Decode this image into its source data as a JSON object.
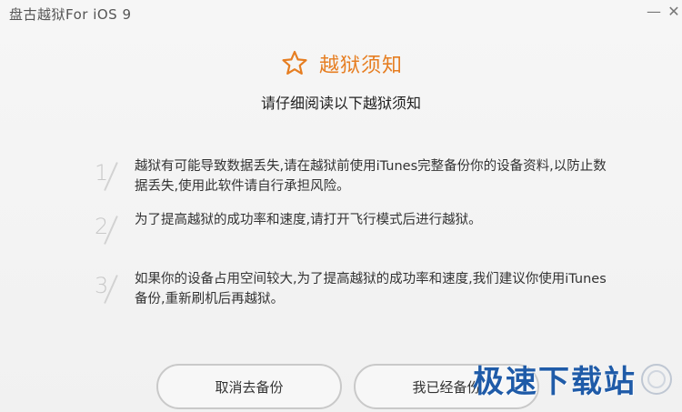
{
  "window": {
    "title": "盘古越狱For iOS 9",
    "minimize_glyph": "—",
    "close_glyph": "✕"
  },
  "brand": {
    "icon": "star-icon",
    "title": "越狱须知",
    "accent_color": "#e67e22"
  },
  "subtitle": "请仔细阅读以下越狱须知",
  "notices": [
    {
      "num": "1",
      "text": "越狱有可能导致数据丢失,请在越狱前使用iTunes完整备份你的设备资料,以防止数据丢失,使用此软件请自行承担风险。"
    },
    {
      "num": "2",
      "text": "为了提高越狱的成功率和速度,请打开飞行模式后进行越狱。"
    },
    {
      "num": "3",
      "text": "如果你的设备占用空间较大,为了提高越狱的成功率和速度,我们建议你使用iTunes备份,重新刷机后再越狱。"
    }
  ],
  "buttons": {
    "cancel": "取消去备份",
    "confirm": "我已经备份"
  },
  "watermark": {
    "text": "极速下载站",
    "color": "#1f5ba8"
  }
}
